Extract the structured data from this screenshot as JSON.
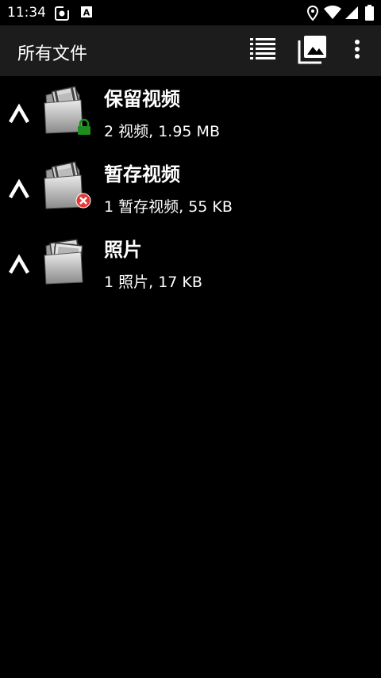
{
  "status_bar": {
    "time": "11:34",
    "left_icons": [
      "screenshot-icon",
      "text-a-icon"
    ],
    "right_icons": [
      "location-icon",
      "wifi-icon",
      "signal-icon",
      "battery-icon"
    ]
  },
  "app_bar": {
    "title": "所有文件",
    "actions": [
      "list-view-icon",
      "gallery-icon",
      "more-vert-icon"
    ]
  },
  "items": [
    {
      "name": "保留视频",
      "info": "2 视频, 1.95 MB",
      "badge": "lock-badge-icon",
      "badge_color": "#1e8c1e"
    },
    {
      "name": "暂存视频",
      "info": "1 暂存视频, 55 KB",
      "badge": "delete-badge-icon",
      "badge_color": "#e53935"
    },
    {
      "name": "照片",
      "info": "1 照片, 17 KB",
      "badge": "",
      "badge_color": ""
    }
  ],
  "colors": {
    "background": "#000000",
    "app_bar": "#1c1c1c",
    "text": "#ffffff"
  }
}
